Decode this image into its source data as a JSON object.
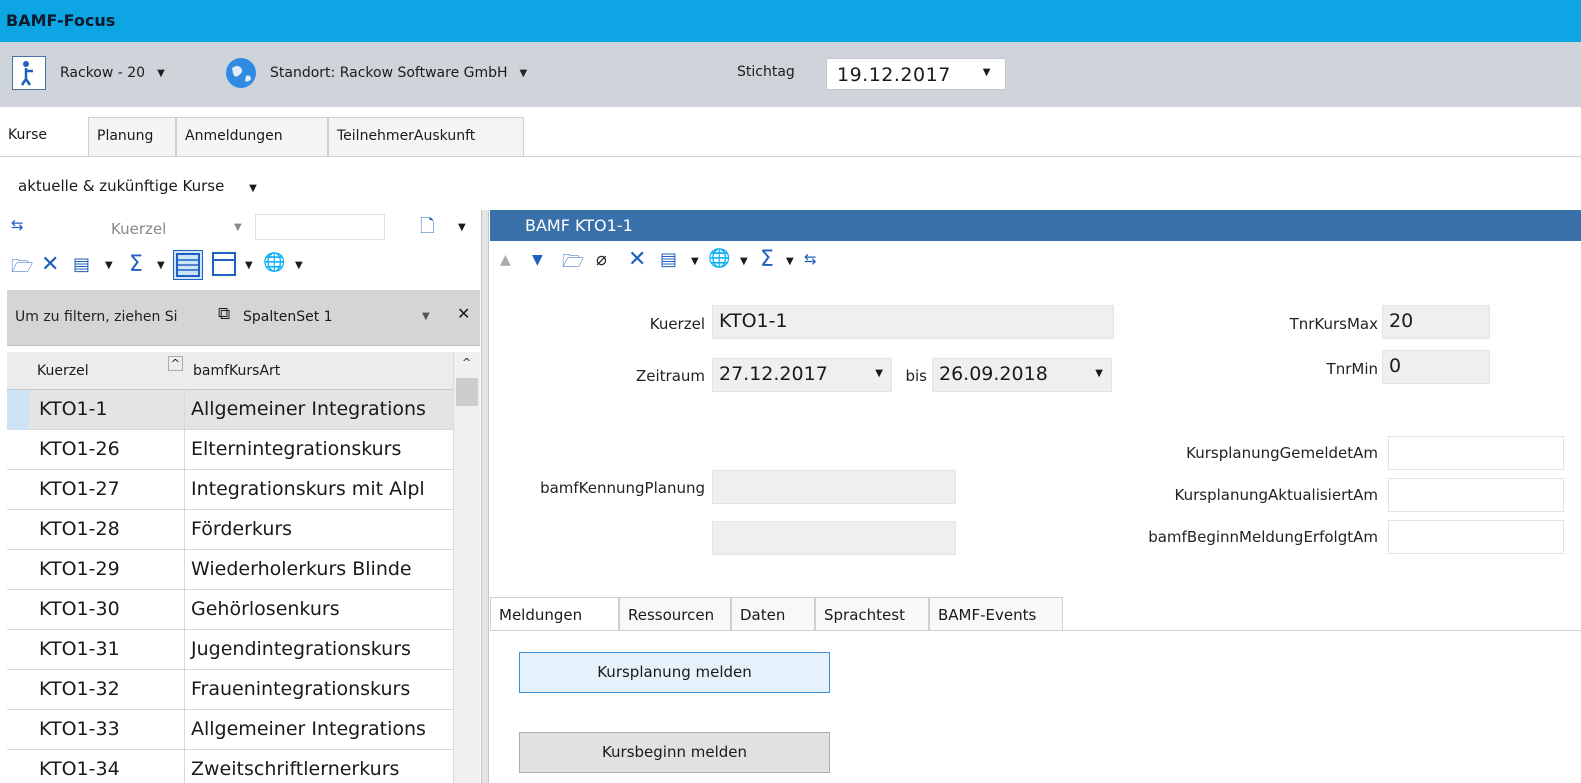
{
  "app": {
    "title": "BAMF-Focus"
  },
  "toolbar": {
    "user": "Rackow - 20",
    "location": "Standort: Rackow Software GmbH",
    "date_label": "Stichtag",
    "date_value": "19.12.2017"
  },
  "tabs": [
    "Kurse",
    "Planung",
    "Anmeldungen",
    "TeilnehmerAuskunft"
  ],
  "filter": {
    "selected": "aktuelle & zukünftige Kurse"
  },
  "left_panel": {
    "search_field_label": "Kuerzel",
    "group_hint": "Um zu filtern, ziehen Si",
    "columnset": "SpaltenSet 1",
    "columns": [
      "Kuerzel",
      "bamfKursArt"
    ],
    "rows": [
      [
        "KTO1-1",
        "Allgemeiner Integrations"
      ],
      [
        "KTO1-26",
        "Elternintegrationskurs"
      ],
      [
        "KTO1-27",
        "Integrationskurs mit Alpl"
      ],
      [
        "KTO1-28",
        "Förderkurs"
      ],
      [
        "KTO1-29",
        "Wiederholerkurs Blinde"
      ],
      [
        "KTO1-30",
        "Gehörlosenkurs"
      ],
      [
        "KTO1-31",
        "Jugendintegrationskurs"
      ],
      [
        "KTO1-32",
        "Frauenintegrationskurs"
      ],
      [
        "KTO1-33",
        "Allgemeiner Integrations"
      ],
      [
        "KTO1-34",
        "Zweitschriftlernerkurs"
      ]
    ]
  },
  "detail": {
    "title": "BAMF KTO1-1",
    "kuerzel_label": "Kuerzel",
    "kuerzel_value": "KTO1-1",
    "zeitraum_label": "Zeitraum",
    "zeitraum_from": "27.12.2017",
    "bis_label": "bis",
    "zeitraum_to": "26.09.2018",
    "tnrkursmax_label": "TnrKursMax",
    "tnrkursmax_value": "20",
    "tnrmin_label": "TnrMin",
    "tnrmin_value": "0",
    "bamfkennung_label": "bamfKennungPlanung",
    "kp_gemeldet_label": "KursplanungGemeldetAm",
    "kp_aktualisiert_label": "KursplanungAktualisiertAm",
    "beginn_meldung_label": "bamfBeginnMeldungErfolgtAm"
  },
  "subtabs": [
    "Meldungen",
    "Ressourcen",
    "Daten",
    "Sprachtest",
    "BAMF-Events"
  ],
  "buttons": {
    "kursplanung": "Kursplanung melden",
    "kursbeginn": "Kursbeginn melden"
  },
  "icons": {
    "user": "user-icon",
    "globe": "globe-icon",
    "sync": "sync-icon",
    "open": "folder-open-icon",
    "delete": "delete-icon",
    "word": "word-icon",
    "sum": "sum-icon",
    "attach": "paperclip-icon"
  },
  "colors": {
    "titlebar": "#0ea5e4",
    "detail_header": "#3a70aa",
    "selection": "#cfe3f7"
  }
}
